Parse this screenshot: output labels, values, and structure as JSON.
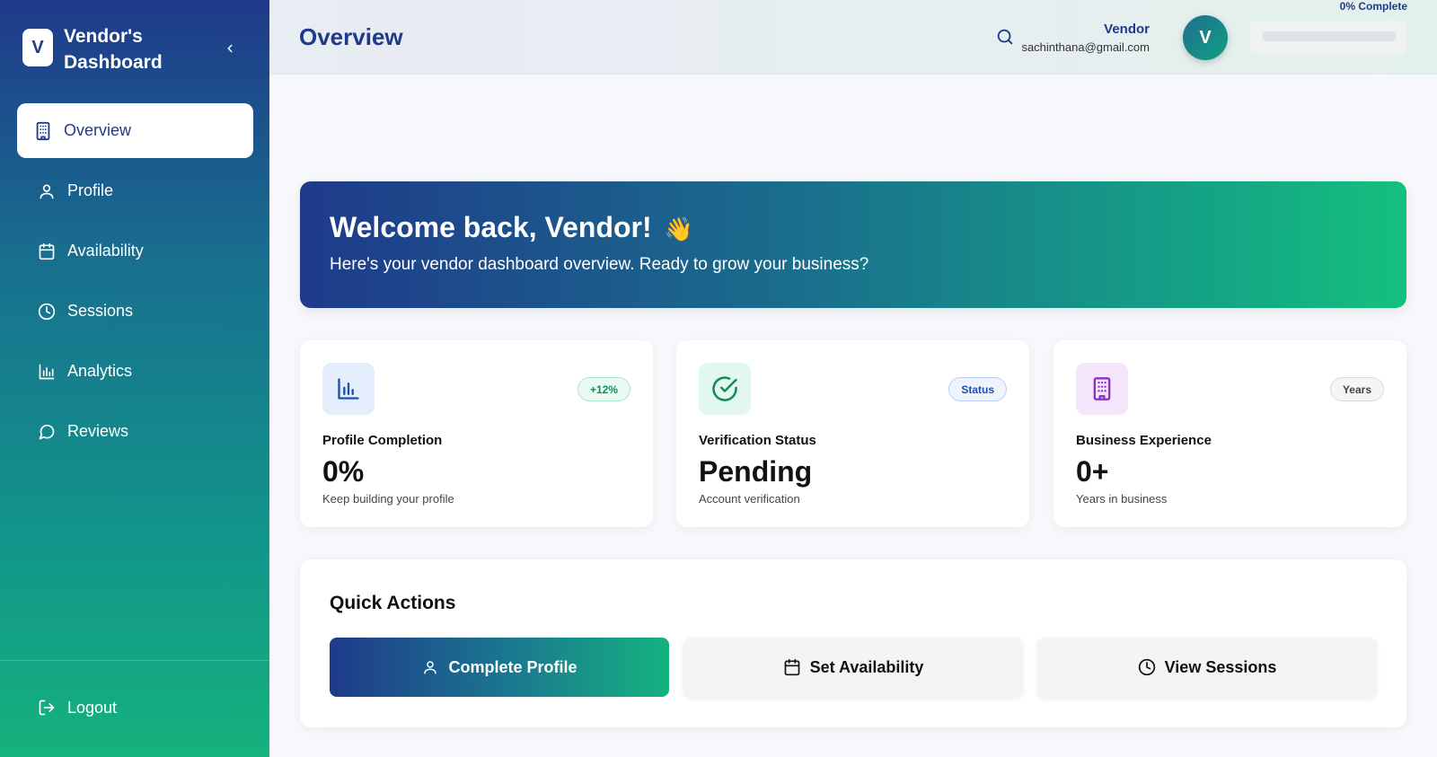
{
  "sidebar": {
    "logo_letter": "V",
    "title": "Vendor's Dashboard",
    "items": [
      {
        "label": "Overview",
        "icon": "building-icon",
        "active": true
      },
      {
        "label": "Profile",
        "icon": "user-icon"
      },
      {
        "label": "Availability",
        "icon": "calendar-icon"
      },
      {
        "label": "Sessions",
        "icon": "clock-icon"
      },
      {
        "label": "Analytics",
        "icon": "bar-chart-icon"
      },
      {
        "label": "Reviews",
        "icon": "message-circle-icon"
      }
    ],
    "logout_label": "Logout"
  },
  "header": {
    "title": "Overview",
    "user_name": "Vendor",
    "user_email": "sachinthana@gmail.com",
    "avatar_letter": "V",
    "progress_label": "0% Complete",
    "progress_percent": 0
  },
  "welcome": {
    "title": "Welcome back, Vendor!",
    "emoji": "👋",
    "subtitle": "Here's your vendor dashboard overview. Ready to grow your business?"
  },
  "stats": [
    {
      "badge": "+12%",
      "label": "Profile Completion",
      "value": "0%",
      "sub": "Keep building your profile",
      "icon": "bar-chart-icon"
    },
    {
      "badge": "Status",
      "label": "Verification Status",
      "value": "Pending",
      "sub": "Account verification",
      "icon": "check-circle-icon"
    },
    {
      "badge": "Years",
      "label": "Business Experience",
      "value": "0+",
      "sub": "Years in business",
      "icon": "building-icon"
    }
  ],
  "quick_actions": {
    "title": "Quick Actions",
    "buttons": [
      {
        "label": "Complete Profile",
        "icon": "user-icon"
      },
      {
        "label": "Set Availability",
        "icon": "calendar-icon"
      },
      {
        "label": "View Sessions",
        "icon": "clock-icon"
      }
    ]
  },
  "colors": {
    "primary": "#1f3a8a",
    "accent": "#15b27d"
  }
}
